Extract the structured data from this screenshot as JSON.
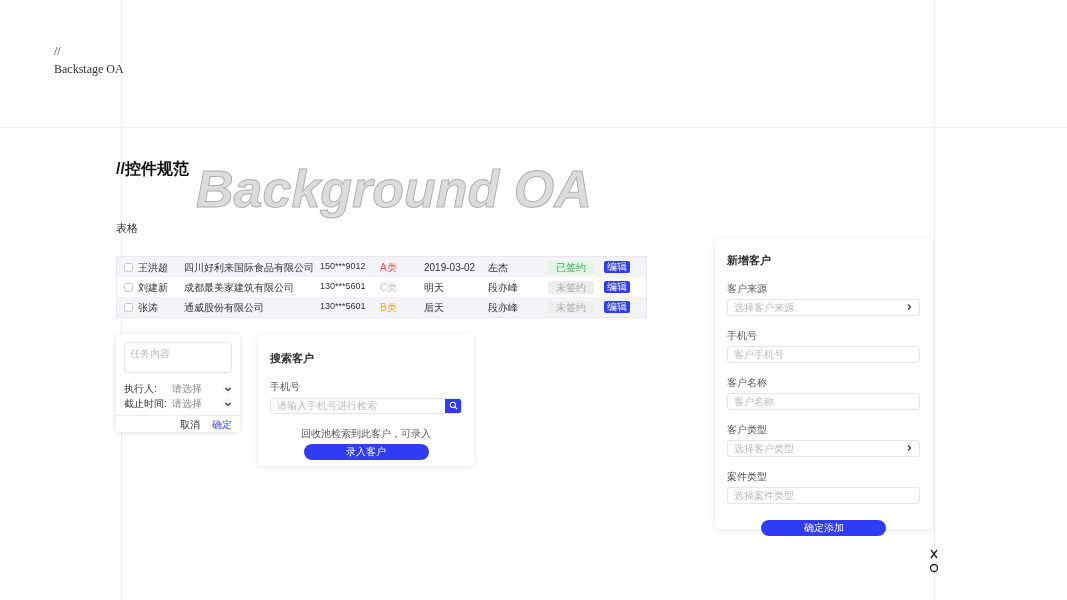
{
  "brand": {
    "mark": "//",
    "name": "Backstage OA"
  },
  "section": {
    "title": "//控件规范",
    "watermark": "Background OA"
  },
  "table": {
    "title": "表格",
    "rows": [
      {
        "checked": false,
        "name": "王洪超",
        "company": "四川好利来国际食品有限公司",
        "phone": "150***9012",
        "category": "A类",
        "color": "#f5554a",
        "date": "2019-03-02",
        "owner": "左杰",
        "status": "已签约",
        "signed": true,
        "action": "编辑"
      },
      {
        "checked": false,
        "name": "刘建新",
        "company": "成都最美家建筑有限公司",
        "phone": "130***5601",
        "category": "C类",
        "color": "#c4c4c4",
        "date": "明天",
        "owner": "段亦峰",
        "status": "未签约",
        "signed": false,
        "action": "编辑"
      },
      {
        "checked": false,
        "name": "张涛",
        "company": "通威股份有限公司",
        "phone": "130***5601",
        "category": "B类",
        "color": "#f5a623",
        "date": "后天",
        "owner": "段亦峰",
        "status": "未签约",
        "signed": false,
        "action": "编辑"
      }
    ]
  },
  "task": {
    "placeholder": "任务内容",
    "fields": [
      {
        "label": "执行人:",
        "value": "请选择"
      },
      {
        "label": "截止时间:",
        "value": "请选择"
      }
    ],
    "cancel": "取消",
    "confirm": "确定"
  },
  "search": {
    "title": "搜索客户",
    "label": "手机号",
    "placeholder": "请输入手机号进行检索",
    "hint": "回收池检索到此客户，可录入",
    "button": "录入客户"
  },
  "add": {
    "title": "新增客户",
    "fields": [
      {
        "label": "客户来源",
        "placeholder": "选择客户来源",
        "kind": "select"
      },
      {
        "label": "手机号",
        "placeholder": "客户手机号",
        "kind": "input"
      },
      {
        "label": "客户名称",
        "placeholder": "客户名称",
        "kind": "input"
      },
      {
        "label": "客户类型",
        "placeholder": "选择客户类型",
        "kind": "select"
      },
      {
        "label": "案件类型",
        "placeholder": "选择案件类型",
        "kind": "input"
      }
    ],
    "button": "确定添加"
  }
}
